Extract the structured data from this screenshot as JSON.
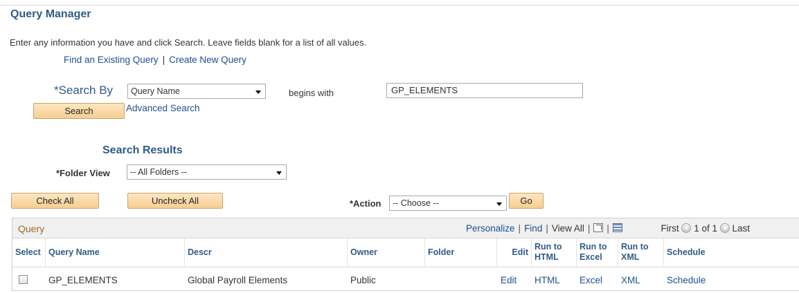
{
  "page": {
    "title": "Query Manager",
    "instructions": "Enter any information you have and click Search. Leave fields blank for a list of all values."
  },
  "nav": {
    "find_existing": "Find an Existing Query",
    "separator": "|",
    "create_new": "Create New Query"
  },
  "search": {
    "search_by_label": "*Search By",
    "search_by_value": "Query Name",
    "operator": "begins with",
    "search_value": "GP_ELEMENTS",
    "search_button": "Search",
    "advanced_search": "Advanced Search"
  },
  "results": {
    "title": "Search Results",
    "folder_view_label": "*Folder View",
    "folder_view_value": "-- All Folders --",
    "check_all": "Check All",
    "uncheck_all": "Uncheck All",
    "action_label": "*Action",
    "action_value": "-- Choose --",
    "go_button": "Go"
  },
  "grid": {
    "title": "Query",
    "personalize": "Personalize",
    "find": "Find",
    "view_all": "View All",
    "first": "First",
    "page_range": "1 of 1",
    "last": "Last",
    "icons": [
      "zoom-icon",
      "download-grid-icon",
      "first-arrow-icon",
      "last-arrow-icon"
    ],
    "columns": {
      "select": "Select",
      "query_name": "Query Name",
      "descr": "Descr",
      "owner": "Owner",
      "folder": "Folder",
      "edit": "Edit",
      "run_html_1": "Run to",
      "run_html_2": "HTML",
      "run_excel_1": "Run to",
      "run_excel_2": "Excel",
      "run_xml_1": "Run to",
      "run_xml_2": "XML",
      "schedule": "Schedule"
    },
    "rows": [
      {
        "query_name": "GP_ELEMENTS",
        "descr": "Global Payroll Elements",
        "owner": "Public",
        "folder": "",
        "edit": "Edit",
        "html": "HTML",
        "excel": "Excel",
        "xml": "XML",
        "schedule": "Schedule"
      }
    ]
  },
  "colors": {
    "title_blue": "#2f5b86",
    "link_blue": "#1d4f91",
    "grid_title_brown": "#a3682a",
    "button_gradient_top": "#fde6c0",
    "button_gradient_bottom": "#f6cf93"
  }
}
